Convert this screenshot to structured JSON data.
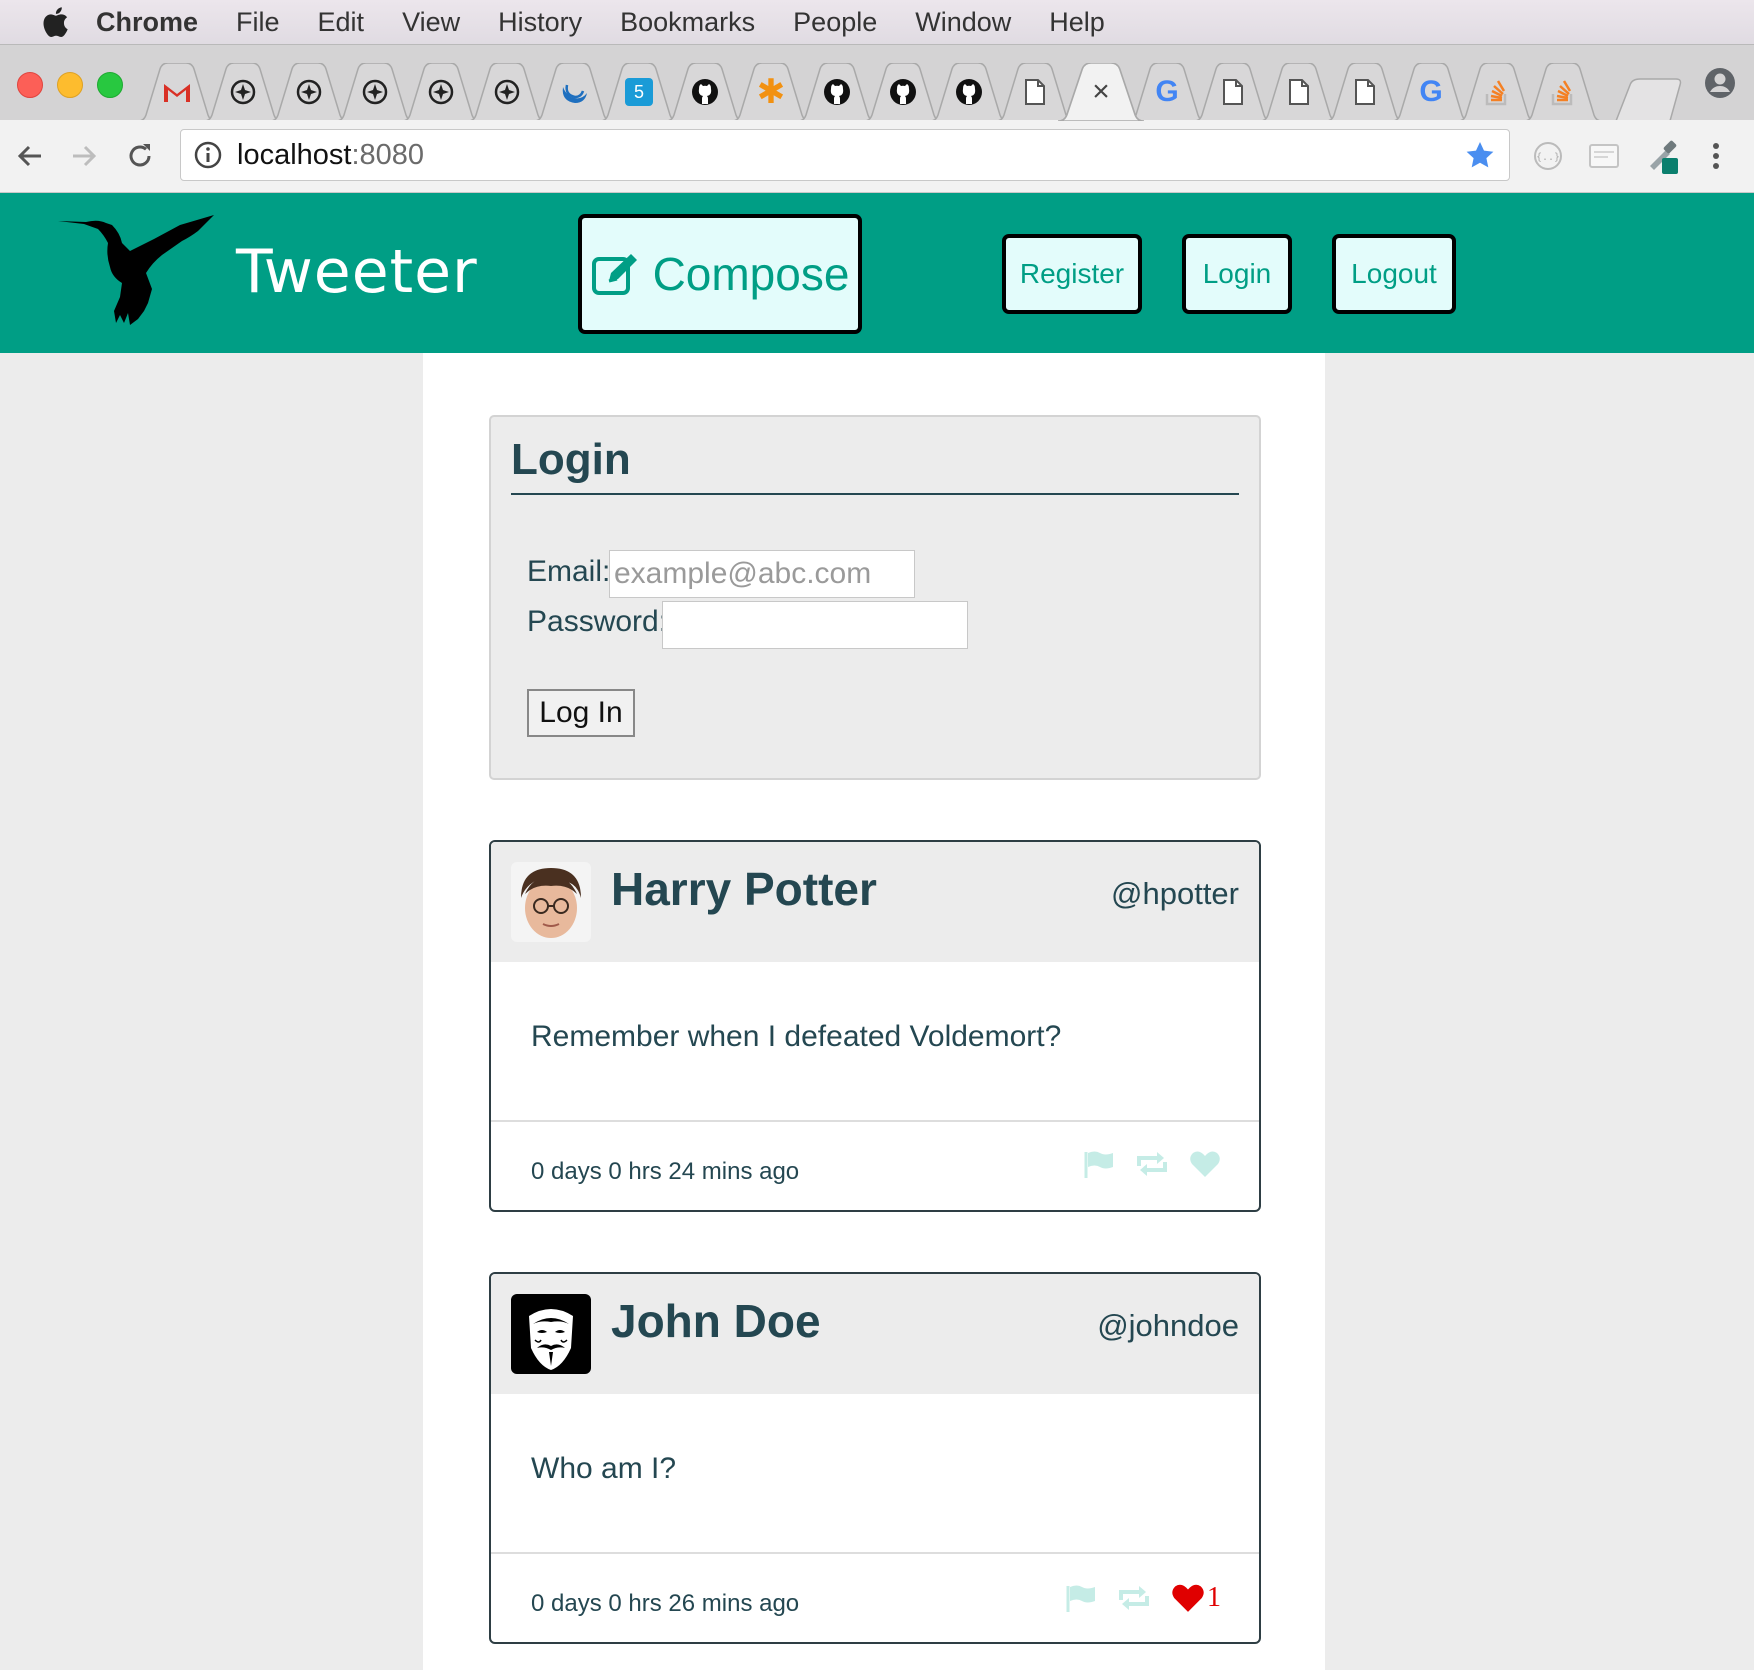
{
  "menubar": {
    "app": "Chrome",
    "items": [
      "File",
      "Edit",
      "View",
      "History",
      "Bookmarks",
      "People",
      "Window",
      "Help"
    ]
  },
  "tabs": [
    {
      "icon": "gmail-icon"
    },
    {
      "icon": "compass-icon"
    },
    {
      "icon": "compass-icon"
    },
    {
      "icon": "compass-icon"
    },
    {
      "icon": "compass-icon"
    },
    {
      "icon": "compass-icon"
    },
    {
      "icon": "moon-icon"
    },
    {
      "icon": "html5-icon",
      "text": "5"
    },
    {
      "icon": "github-icon"
    },
    {
      "icon": "asterisk-icon",
      "text": "✱"
    },
    {
      "icon": "github-icon"
    },
    {
      "icon": "github-icon"
    },
    {
      "icon": "github-icon"
    },
    {
      "icon": "page-icon"
    },
    {
      "icon": "close-icon",
      "text": "×",
      "active": true
    },
    {
      "icon": "google-icon",
      "text": "G"
    },
    {
      "icon": "page-icon"
    },
    {
      "icon": "page-icon"
    },
    {
      "icon": "page-icon"
    },
    {
      "icon": "google-icon",
      "text": "G"
    },
    {
      "icon": "stackoverflow-icon"
    },
    {
      "icon": "stackoverflow-icon"
    }
  ],
  "toolbar": {
    "url_host": "localhost",
    "url_port": ":8080"
  },
  "header": {
    "brand": "Tweeter",
    "compose_label": "Compose",
    "register_label": "Register",
    "login_label": "Login",
    "logout_label": "Logout"
  },
  "login": {
    "title": "Login",
    "email_label": "Email:",
    "email_placeholder": "example@abc.com",
    "password_label": "Password:",
    "submit_label": "Log In"
  },
  "tweets": [
    {
      "name": "Harry Potter",
      "handle": "@hpotter",
      "body": "Remember when I defeated Voldemort?",
      "time": "0 days 0 hrs 24 mins ago",
      "liked": false,
      "like_count": ""
    },
    {
      "name": "John Doe",
      "handle": "@johndoe",
      "body": "Who am I?",
      "time": "0 days 0 hrs 26 mins ago",
      "liked": true,
      "like_count": "1"
    }
  ],
  "colors": {
    "brand_green": "#009e85",
    "button_bg": "#e3fcfb",
    "text_dark": "#244751",
    "icon_faded": "#c5ece6",
    "like_red": "#e00000"
  }
}
